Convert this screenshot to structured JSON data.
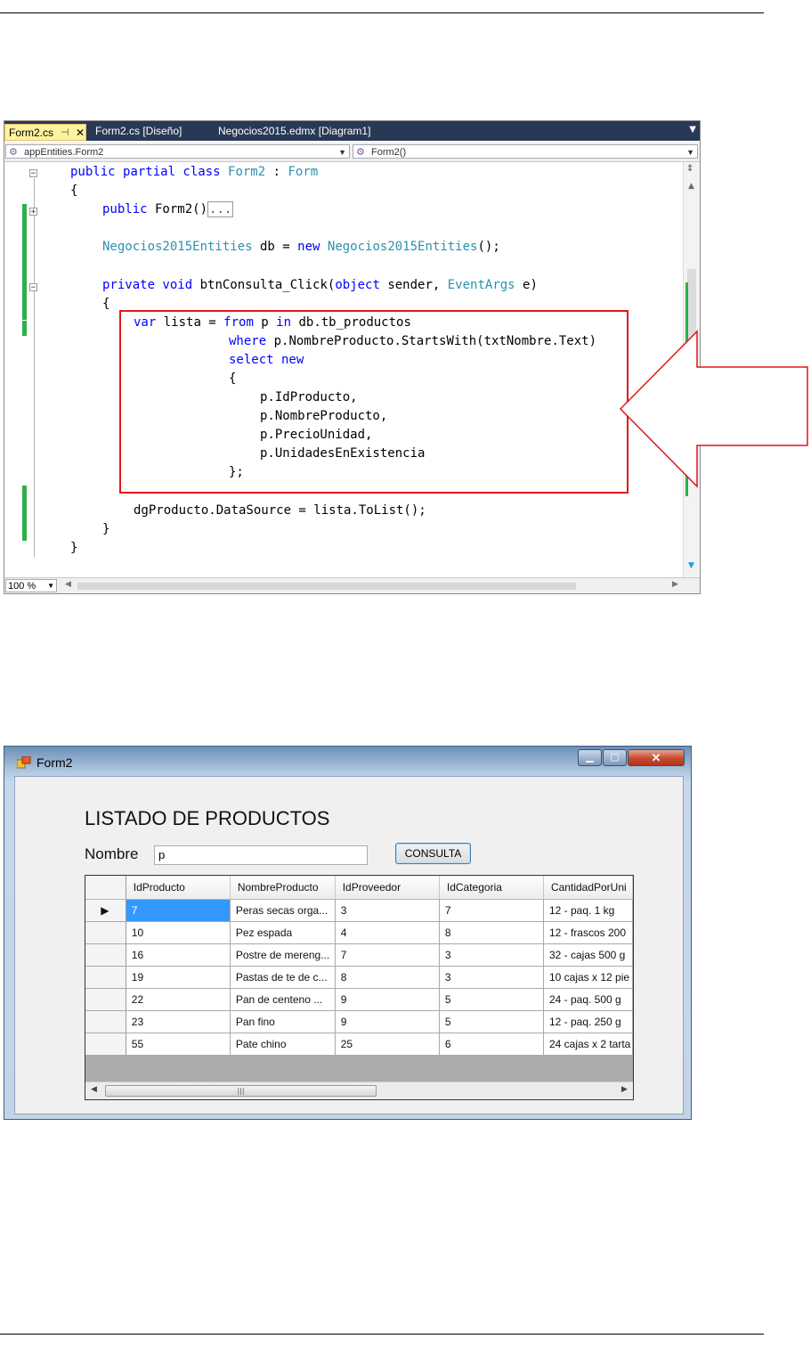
{
  "editor": {
    "tabs": [
      {
        "label": "Form2.cs"
      },
      {
        "label": "Form2.cs [Diseño]"
      },
      {
        "label": "Negocios2015.edmx [Diagram1]"
      }
    ],
    "nav_left": "appEntities.Form2",
    "nav_right": "Form2()",
    "zoom": "100 %",
    "code_lines": [
      [
        "public partial class Form2 : Form",
        [
          [
            "kw",
            "public partial class "
          ],
          [
            "ty",
            "Form2"
          ],
          [
            "",
            "  : "
          ],
          [
            "ty",
            "Form"
          ]
        ]
      ],
      [
        "{"
      ],
      [
        "public Form2()..."
      ],
      [
        ""
      ],
      [
        "Negocios2015Entities db = new Negocios2015Entities();"
      ],
      [
        ""
      ],
      [
        "private void btnConsulta_Click(object sender, EventArgs e)"
      ],
      [
        "{"
      ],
      [
        "var lista = from p in db.tb_productos"
      ],
      [
        "where p.NombreProducto.StartsWith(txtNombre.Text)"
      ],
      [
        "select new"
      ],
      [
        "{"
      ],
      [
        "p.IdProducto,"
      ],
      [
        "p.NombreProducto,"
      ],
      [
        "p.PrecioUnidad,"
      ],
      [
        "p.UnidadesEnExistencia"
      ],
      [
        "};"
      ],
      [
        ""
      ],
      [
        "dgProducto.DataSource = lista.ToList();"
      ],
      [
        "}"
      ],
      [
        "}"
      ]
    ]
  },
  "form": {
    "window_title": "Form2",
    "heading": "LISTADO DE PRODUCTOS",
    "nombre_label": "Nombre",
    "nombre_value": "p",
    "consulta_label": "CONSULTA",
    "columns": [
      "IdProducto",
      "NombreProducto",
      "IdProveedor",
      "IdCategoria",
      "CantidadPorUni"
    ],
    "rows": [
      [
        "7",
        "Peras secas orga...",
        "3",
        "7",
        "12 - paq. 1 kg"
      ],
      [
        "10",
        "Pez espada",
        "4",
        "8",
        "12 - frascos 200"
      ],
      [
        "16",
        "Postre de mereng...",
        "7",
        "3",
        "32 - cajas 500 g"
      ],
      [
        "19",
        "Pastas de te de c...",
        "8",
        "3",
        "10 cajas x 12 pie"
      ],
      [
        "22",
        "Pan de centeno ...",
        "9",
        "5",
        "24 - paq. 500 g"
      ],
      [
        "23",
        "Pan fino",
        "9",
        "5",
        "12 - paq. 250 g"
      ],
      [
        "55",
        "Pate chino",
        "25",
        "6",
        "24 cajas x 2 tarta"
      ]
    ],
    "selected_row": 0
  },
  "colors": {
    "keyword": "#0000ff",
    "type": "#2b91af",
    "highlight": "#e1151b",
    "selection": "#3399ff"
  }
}
